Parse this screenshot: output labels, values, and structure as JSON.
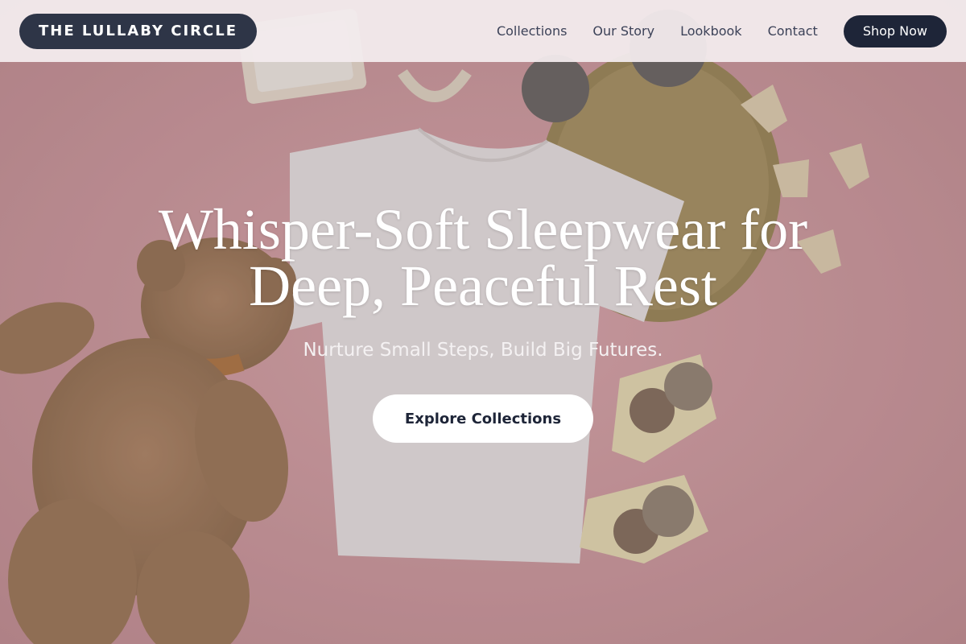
{
  "brand": {
    "name": "THE LULLABY CIRCLE"
  },
  "nav": {
    "links": [
      "Collections",
      "Our Story",
      "Lookbook",
      "Contact"
    ],
    "cta_label": "Shop Now"
  },
  "hero": {
    "title_line1": "Whisper-Soft Sleepwear for",
    "title_line2": "Deep, Peaceful Rest",
    "subtitle": "Nurture Small Steps, Build Big Futures.",
    "cta_label": "Explore Collections",
    "background_image": "baby-clothing-flatlay-photo"
  },
  "colors": {
    "header_bg": "#f3ecee",
    "logo_bg": "#2e3547",
    "nav_text": "#3c4258",
    "shop_btn_bg": "#1e2538",
    "hero_bg_pink": "#d9a3a6",
    "cta_bg": "#ffffff",
    "cta_text": "#1e2538"
  }
}
